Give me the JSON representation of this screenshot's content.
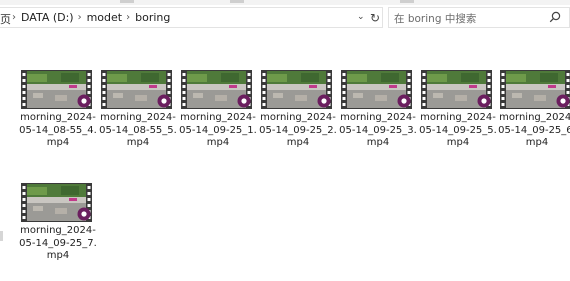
{
  "breadcrumb": {
    "fragment": "页",
    "items": [
      "DATA (D:)",
      "modet",
      "boring"
    ]
  },
  "search": {
    "placeholder": "在 boring 中搜索"
  },
  "files": [
    {
      "line1": "morning_2024-",
      "line2": "05-14_08-55_4.",
      "line3": "mp4"
    },
    {
      "line1": "morning_2024-",
      "line2": "05-14_08-55_5.",
      "line3": "mp4"
    },
    {
      "line1": "morning_2024-",
      "line2": "05-14_09-25_1.",
      "line3": "mp4"
    },
    {
      "line1": "morning_2024-",
      "line2": "05-14_09-25_2.",
      "line3": "mp4"
    },
    {
      "line1": "morning_2024-",
      "line2": "05-14_09-25_3.",
      "line3": "mp4"
    },
    {
      "line1": "morning_2024-",
      "line2": "05-14_09-25_5.",
      "line3": "mp4"
    },
    {
      "line1": "morning_2024-",
      "line2": "05-14_09-25_6.",
      "line3": "mp4"
    },
    {
      "line1": "morning_2024-",
      "line2": "05-14_09-25_7.",
      "line3": "mp4"
    }
  ],
  "icons": {
    "film": "film-strip-icon",
    "badge": "media-player-badge-icon",
    "badge_color": "#6b1f5f"
  }
}
